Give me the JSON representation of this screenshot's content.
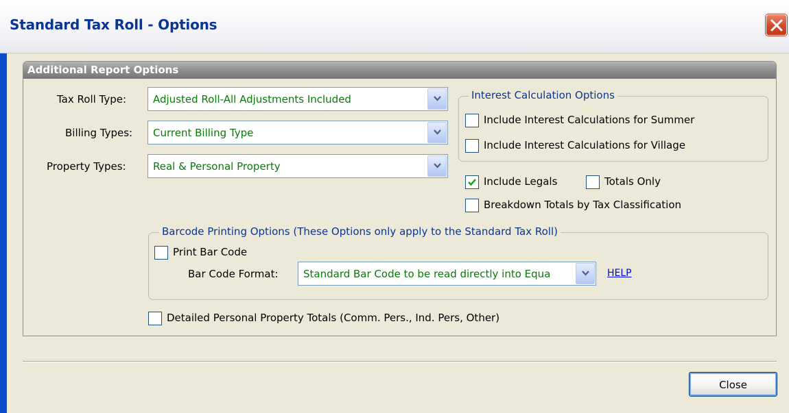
{
  "window": {
    "title": "Standard Tax Roll -  Options"
  },
  "panel": {
    "header": "Additional Report Options"
  },
  "fields": {
    "tax_roll_type": {
      "label": "Tax Roll Type:",
      "value": "Adjusted Roll-All Adjustments Included"
    },
    "billing_types": {
      "label": "Billing Types:",
      "value": "Current Billing Type"
    },
    "property_types": {
      "label": "Property Types:",
      "value": "Real & Personal Property"
    }
  },
  "interest": {
    "title": "Interest Calculation Options",
    "summer": {
      "label": "Include Interest Calculations for Summer",
      "checked": false
    },
    "village": {
      "label": "Include Interest Calculations for Village",
      "checked": false
    }
  },
  "options": {
    "include_legals": {
      "label": "Include Legals",
      "checked": true
    },
    "totals_only": {
      "label": "Totals Only",
      "checked": false
    },
    "breakdown": {
      "label": "Breakdown Totals by Tax Classification",
      "checked": false
    }
  },
  "barcode": {
    "title": "Barcode Printing Options (These Options only apply to the Standard Tax Roll)",
    "print": {
      "label": "Print Bar Code",
      "checked": false
    },
    "format_label": "Bar Code Format:",
    "format_value": "Standard Bar Code to be read directly into Equa",
    "help": "HELP"
  },
  "detailed": {
    "label": "Detailed Personal Property Totals (Comm. Pers., Ind. Pers, Other)",
    "checked": false
  },
  "buttons": {
    "close": "Close"
  },
  "colors": {
    "title": "#0b3592",
    "value_text": "#0a7a0a",
    "group_title": "#0b3592",
    "link": "#0000ee"
  }
}
